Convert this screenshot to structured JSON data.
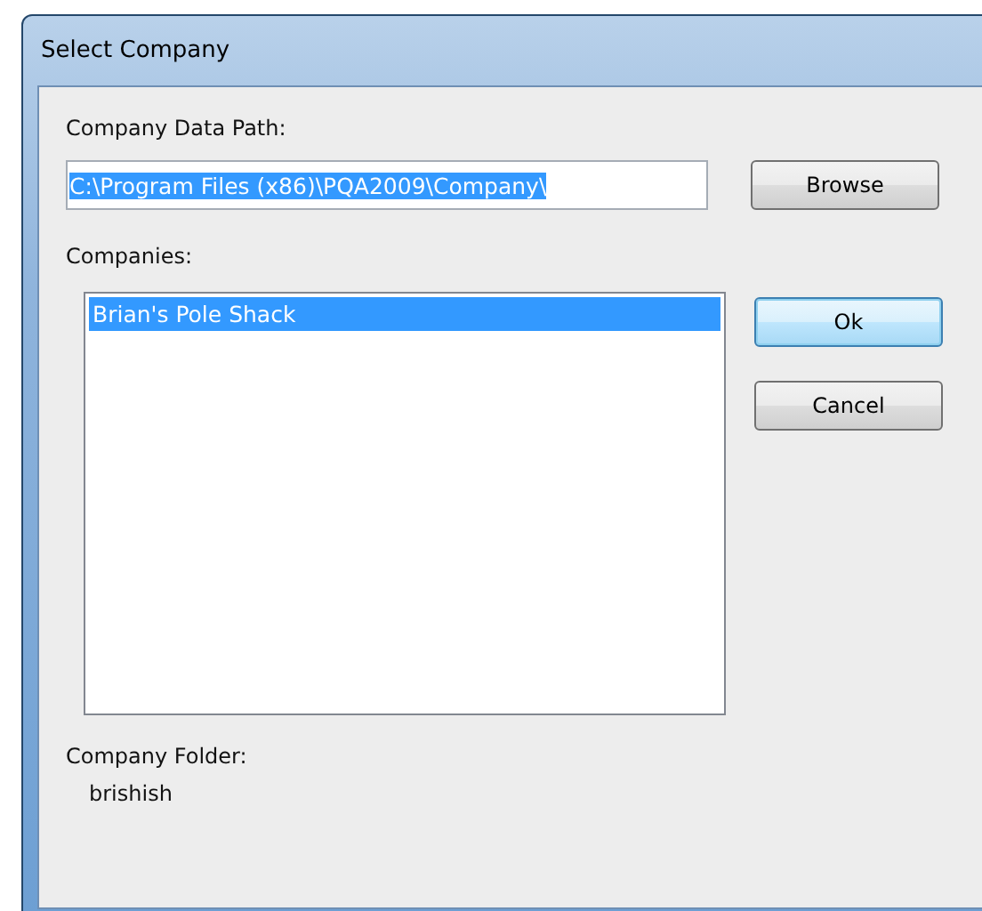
{
  "window": {
    "title": "Select Company"
  },
  "path": {
    "label": "Company Data Path:",
    "value": "C:\\Program Files (x86)\\PQA2009\\Company\\",
    "text_selected": true
  },
  "companies": {
    "label": "Companies:",
    "items": [
      {
        "name": "Brian's Pole Shack",
        "selected": true
      }
    ]
  },
  "buttons": [
    {
      "kind": "browse",
      "label": "Browse",
      "default": false
    },
    {
      "kind": "ok",
      "label": "Ok",
      "default": true
    },
    {
      "kind": "cancel",
      "label": "Cancel",
      "default": false
    }
  ],
  "folder": {
    "label": "Company Folder:",
    "value": "brishish"
  }
}
